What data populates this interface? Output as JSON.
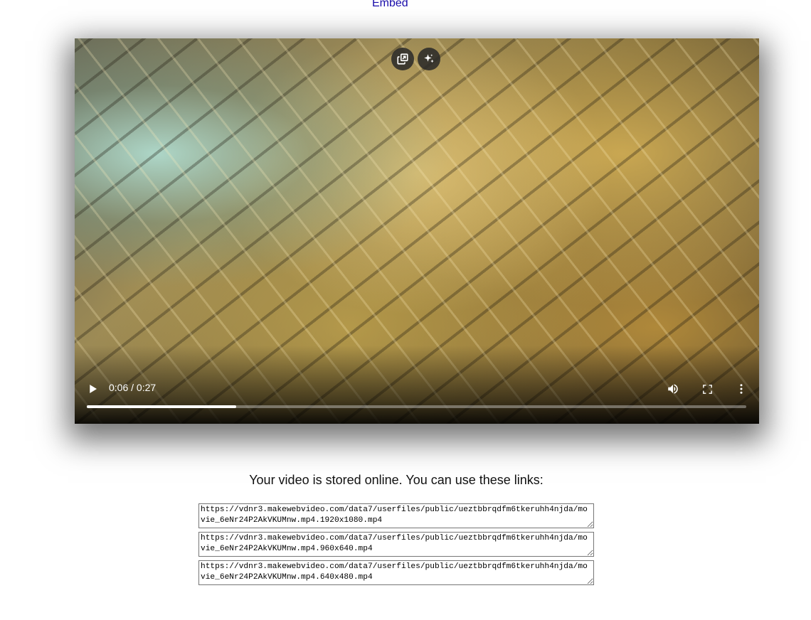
{
  "embed_link": "Embed",
  "video": {
    "current_time": "0:06",
    "duration": "0:27",
    "time_display": "0:06 / 0:27",
    "progress_fraction": 0.227,
    "overlay_icons": [
      "picture-in-picture-icon",
      "sparkle-icon"
    ],
    "control_icons": [
      "play-icon",
      "volume-icon",
      "fullscreen-icon",
      "more-options-icon"
    ]
  },
  "info_text": "Your video is stored online. You can use these links:",
  "links": [
    "https://vdnr3.makewebvideo.com/data7/userfiles/public/ueztbbrqdfm6tkeruhh4njda/movie_6eNr24P2AkVKUMnw.mp4.1920x1080.mp4",
    "https://vdnr3.makewebvideo.com/data7/userfiles/public/ueztbbrqdfm6tkeruhh4njda/movie_6eNr24P2AkVKUMnw.mp4.960x640.mp4",
    "https://vdnr3.makewebvideo.com/data7/userfiles/public/ueztbbrqdfm6tkeruhh4njda/movie_6eNr24P2AkVKUMnw.mp4.640x480.mp4"
  ],
  "colors": {
    "link": "#1a0dab",
    "controls": "#ffffff"
  }
}
